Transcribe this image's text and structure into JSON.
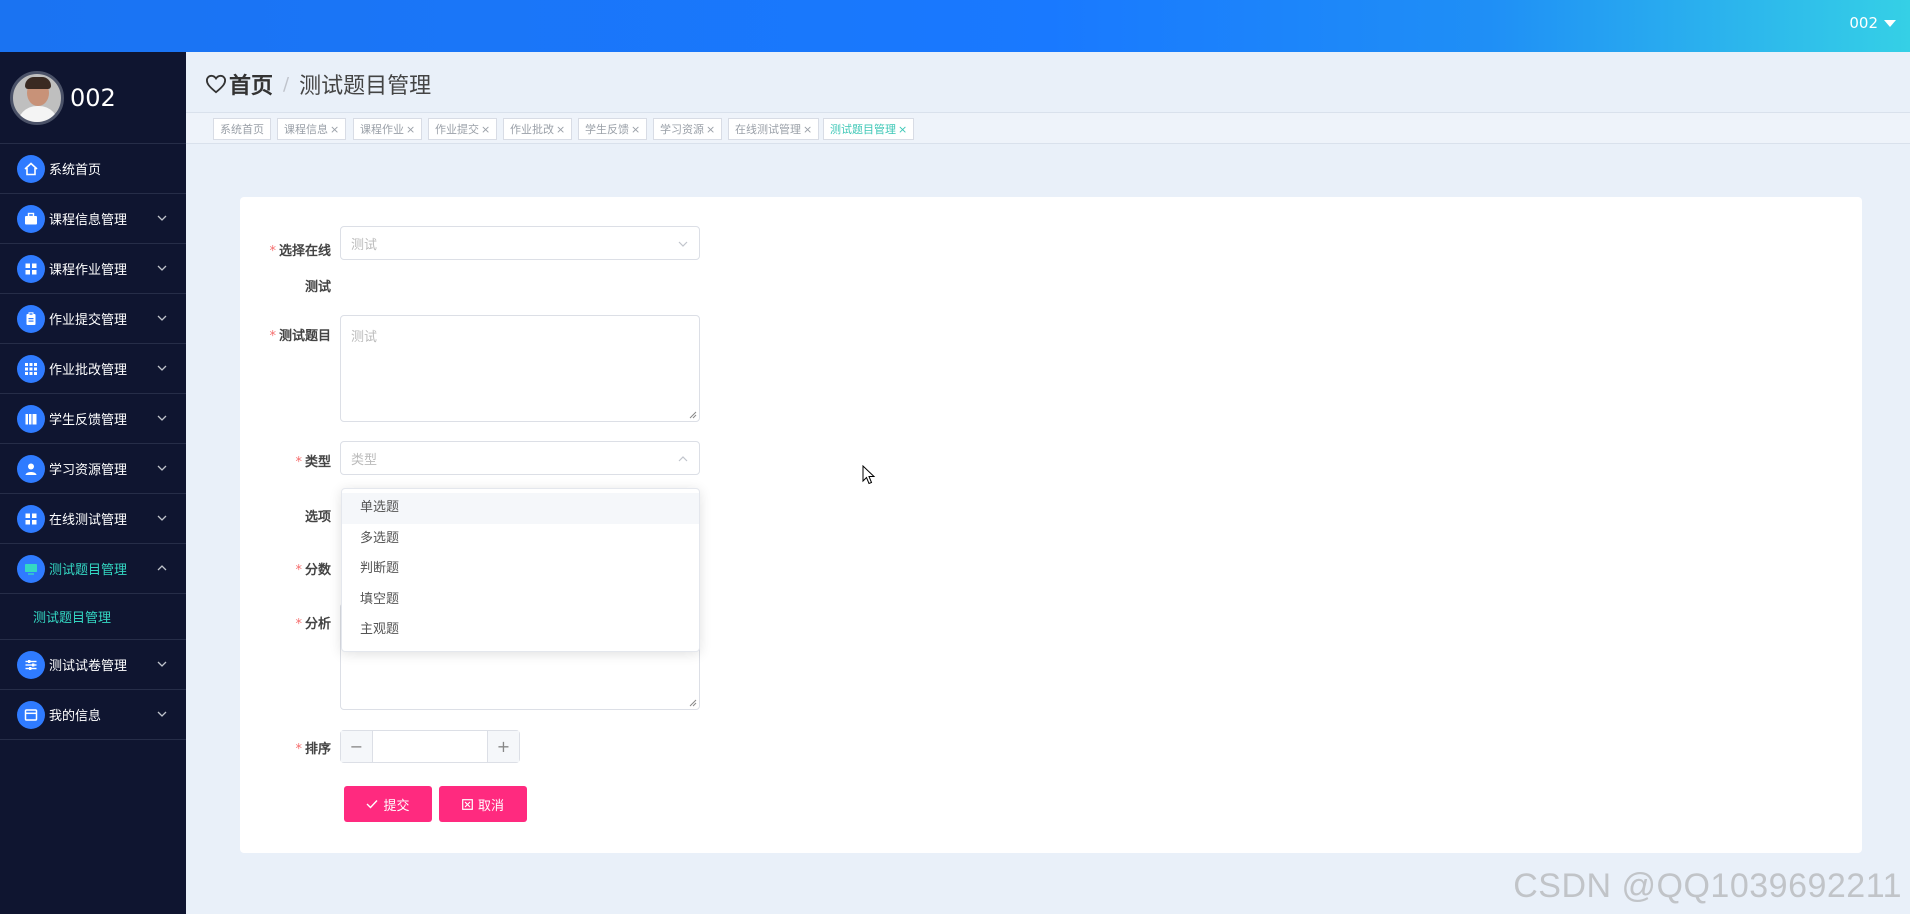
{
  "topbar": {
    "user_label": "002"
  },
  "sidebar": {
    "profile_name": "002",
    "items": [
      {
        "label": "系统首页",
        "icon": "home-icon"
      },
      {
        "label": "课程信息管理",
        "icon": "briefcase-icon"
      },
      {
        "label": "课程作业管理",
        "icon": "grid-icon"
      },
      {
        "label": "作业提交管理",
        "icon": "clipboard-icon"
      },
      {
        "label": "作业批改管理",
        "icon": "apps-icon"
      },
      {
        "label": "学生反馈管理",
        "icon": "books-icon"
      },
      {
        "label": "学习资源管理",
        "icon": "user-icon"
      },
      {
        "label": "在线测试管理",
        "icon": "grid-icon"
      },
      {
        "label": "测试题目管理",
        "icon": "monitor-icon"
      },
      {
        "label": "测试试卷管理",
        "icon": "sliders-icon"
      },
      {
        "label": "我的信息",
        "icon": "window-icon"
      }
    ],
    "submenu_label": "测试题目管理"
  },
  "breadcrumb": {
    "home": "首页",
    "separator": "/",
    "current": "测试题目管理"
  },
  "tabs": [
    {
      "label": "系统首页",
      "closable": false
    },
    {
      "label": "课程信息",
      "closable": true
    },
    {
      "label": "课程作业",
      "closable": true
    },
    {
      "label": "作业提交",
      "closable": true
    },
    {
      "label": "作业批改",
      "closable": true
    },
    {
      "label": "学生反馈",
      "closable": true
    },
    {
      "label": "学习资源",
      "closable": true
    },
    {
      "label": "在线测试管理",
      "closable": true
    },
    {
      "label": "测试题目管理",
      "closable": true,
      "active": true
    }
  ],
  "form": {
    "exam_label_line1": "选择在线",
    "exam_label_line2": "测试",
    "exam_placeholder": "测试",
    "question_label": "测试题目",
    "question_placeholder": "测试",
    "type_label": "类型",
    "type_placeholder": "类型",
    "options_label": "选项",
    "score_label": "分数",
    "analysis_label": "分析",
    "order_label": "排序",
    "order_value": "",
    "submit_label": "提交",
    "cancel_label": "取消"
  },
  "type_dropdown": {
    "options": [
      "单选题",
      "多选题",
      "判断题",
      "填空题",
      "主观题"
    ],
    "hovered_index": 0
  },
  "watermark": "CSDN @QQ1039692211",
  "colors": {
    "accent": "#ff2a7f",
    "sidebar_bg": "#0f1530",
    "active_text": "#34d8c3",
    "icon_bg": "#2f7bff"
  }
}
